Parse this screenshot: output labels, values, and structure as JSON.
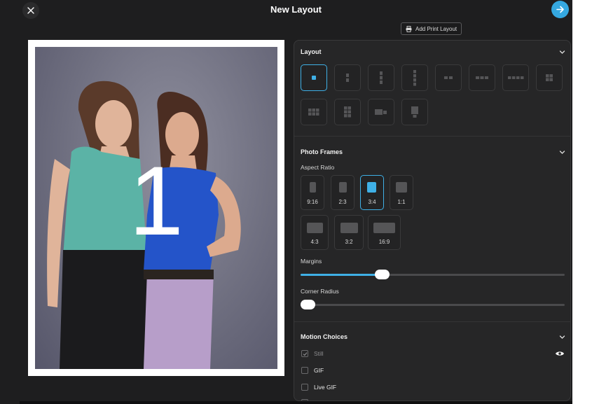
{
  "header": {
    "title": "New Layout",
    "close_icon": "close-icon",
    "next_icon": "arrow-right-icon",
    "accent": "#35a8e0"
  },
  "print_button": {
    "label": "Add Print Layout",
    "icon": "printer-icon"
  },
  "preview": {
    "slot_number": "1"
  },
  "layout_section": {
    "title": "Layout",
    "selected_index": 0,
    "tiles": [
      "single",
      "two-vertical",
      "three-vertical",
      "four-vertical",
      "two-horizontal",
      "three-horizontal",
      "four-horizontal",
      "grid-2x2",
      "grid-3x2",
      "grid-2x3",
      "wide-plus-square",
      "tall-plus-square"
    ]
  },
  "photo_frames": {
    "title": "Photo Frames",
    "aspect_ratio_label": "Aspect Ratio",
    "selected": "3:4",
    "ratios": [
      {
        "label": "9:16"
      },
      {
        "label": "2:3"
      },
      {
        "label": "3:4"
      },
      {
        "label": "1:1"
      },
      {
        "label": "4:3"
      },
      {
        "label": "3:2"
      },
      {
        "label": "16:9"
      }
    ],
    "margins_label": "Margins",
    "margins_value": 0.31,
    "corner_radius_label": "Corner Radius",
    "corner_radius_value": 0.0
  },
  "motion": {
    "title": "Motion Choices",
    "options": [
      {
        "label": "Still",
        "checked": true,
        "disabled": true
      },
      {
        "label": "GIF",
        "checked": false,
        "disabled": false
      },
      {
        "label": "Live GIF",
        "checked": false,
        "disabled": false
      }
    ],
    "visibility_icon": "eye-icon"
  }
}
